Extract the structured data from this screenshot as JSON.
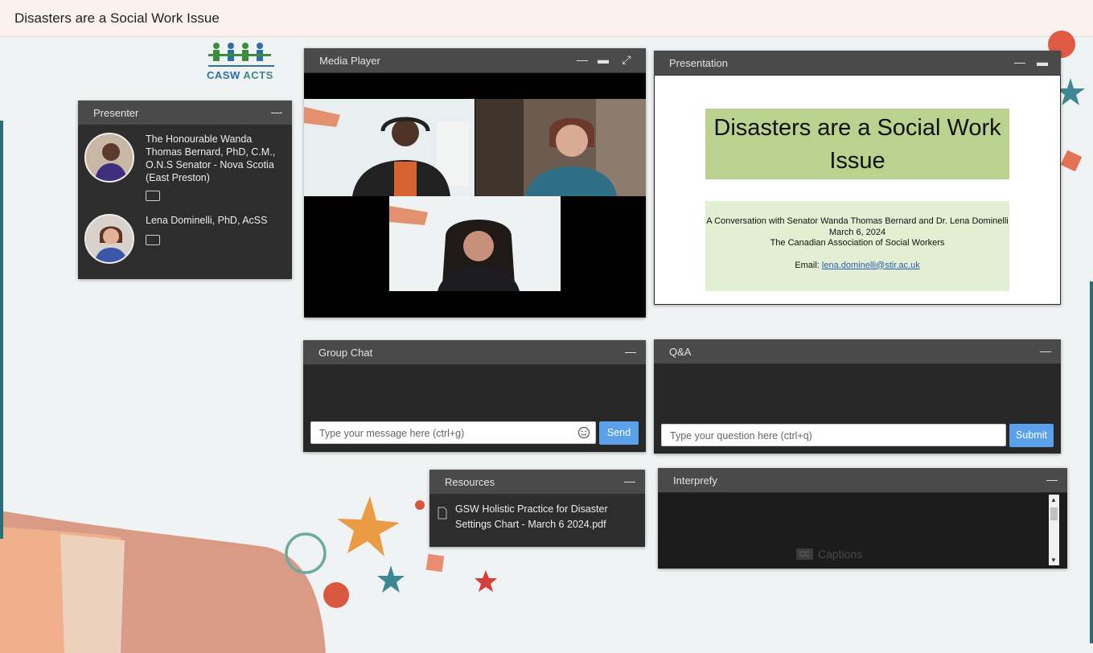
{
  "page": {
    "title": "Disasters are a Social Work Issue"
  },
  "logo": {
    "left_text": "CASW",
    "right_text": "ACTS"
  },
  "presenter": {
    "title": "Presenter",
    "people": [
      {
        "name": "The Honourable Wanda Thomas Bernard, PhD, C.M., O.N.S Senator - Nova Scotia (East Preston)"
      },
      {
        "name": "Lena Dominelli, PhD, AcSS"
      }
    ]
  },
  "media": {
    "title": "Media Player"
  },
  "presentation": {
    "title": "Presentation",
    "slide_title": "Disasters are a Social Work Issue",
    "slide_line1": "A Conversation with Senator Wanda Thomas Bernard and Dr. Lena Dominelli",
    "slide_line2": "March 6, 2024",
    "slide_line3": "The Canadian Association of Social Workers",
    "slide_email_label": "Email: ",
    "slide_email": "lena.dominelli@stir.ac.uk"
  },
  "chat": {
    "title": "Group Chat",
    "placeholder": "Type your message here (ctrl+g)",
    "send": "Send"
  },
  "qa": {
    "title": "Q&A",
    "placeholder": "Type your question here (ctrl+q)",
    "submit": "Submit"
  },
  "resources": {
    "title": "Resources",
    "items": [
      {
        "name": "GSW Holistic Practice for Disaster Settings Chart - March 6 2024.pdf"
      }
    ]
  },
  "interprefy": {
    "title": "Interprefy",
    "cc_label": "CC",
    "captions": "Captions"
  },
  "colors": {
    "accent_blue": "#5aa1ea",
    "panel_header": "#4a4a4a",
    "panel_body": "#2d2d2d",
    "slide_green": "#b9d28d"
  }
}
